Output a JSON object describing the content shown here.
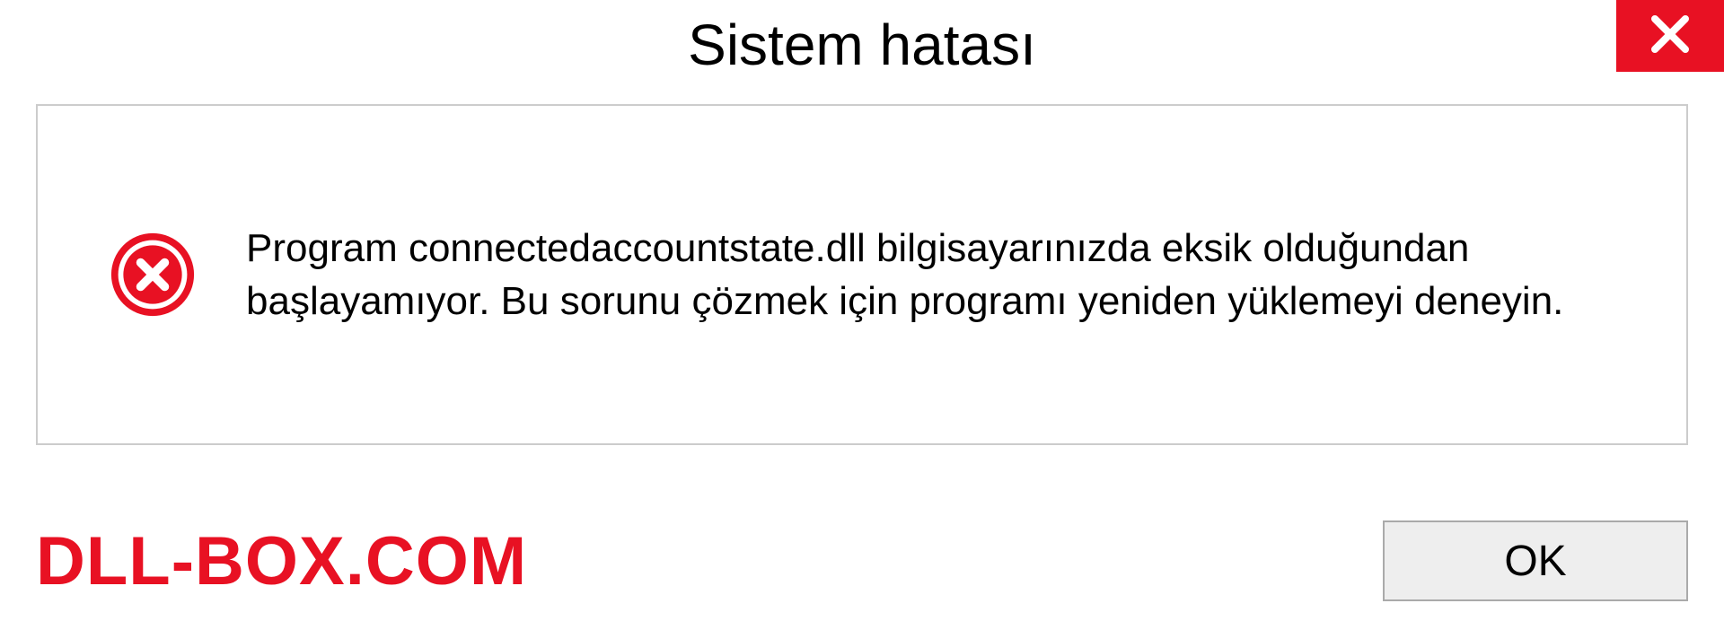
{
  "title": "Sistem hatası",
  "message": "Program connectedaccountstate.dll bilgisayarınızda eksik olduğundan başlayamıyor. Bu sorunu çözmek için programı yeniden yüklemeyi deneyin.",
  "watermark": "DLL-BOX.COM",
  "ok_label": "OK",
  "colors": {
    "close_bg": "#e81123",
    "watermark": "#e81123",
    "border": "#cccccc"
  }
}
